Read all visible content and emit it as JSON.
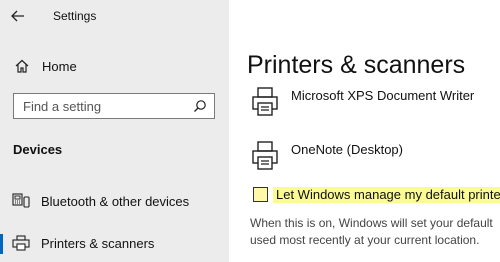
{
  "titlebar": {
    "title": "Settings"
  },
  "sidebar": {
    "home_label": "Home",
    "search": {
      "placeholder": "Find a setting"
    },
    "section_heading": "Devices",
    "items": [
      {
        "label": "Bluetooth & other devices",
        "icon": "bluetooth-devices-icon"
      },
      {
        "label": "Printers & scanners",
        "icon": "printer-icon",
        "selected": true
      }
    ]
  },
  "main": {
    "title": "Printers & scanners",
    "devices": [
      {
        "name": "Microsoft XPS Document Writer",
        "icon": "printer-icon"
      },
      {
        "name": "OneNote (Desktop)",
        "icon": "printer-icon"
      }
    ],
    "default_printer_checkbox": {
      "label": "Let Windows manage my default printer",
      "checked": false
    },
    "description_line1": "When this is on, Windows will set your default",
    "description_line2": "used most recently at your current location."
  },
  "colors": {
    "sidebar_bg": "#ececec",
    "accent": "#0067c0",
    "highlight": "#fbfb94"
  }
}
